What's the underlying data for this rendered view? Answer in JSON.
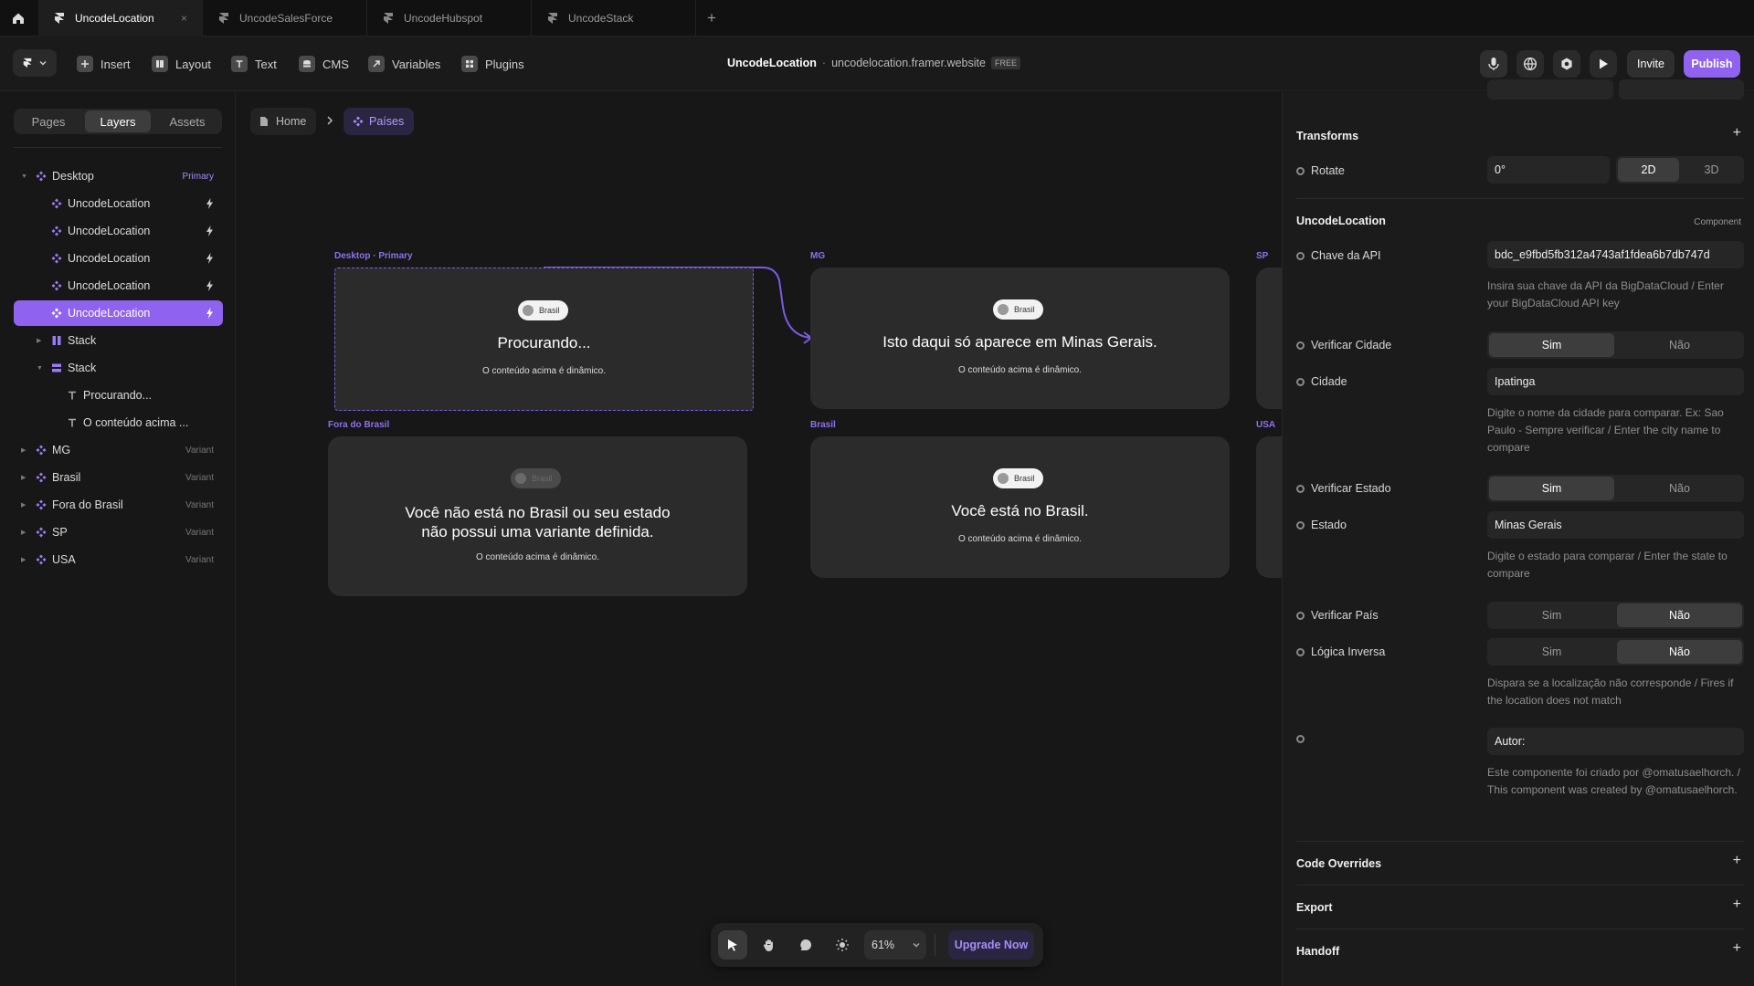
{
  "tabs": [
    {
      "label": "UncodeLocation",
      "close": "×"
    },
    {
      "label": "UncodeSalesForce"
    },
    {
      "label": "UncodeHubspot"
    },
    {
      "label": "UncodeStack"
    }
  ],
  "new_tab": "+",
  "toolbar": {
    "insert": "Insert",
    "layout": "Layout",
    "text": "Text",
    "cms": "CMS",
    "variables": "Variables",
    "plugins": "Plugins",
    "project_name": "UncodeLocation",
    "separator": "·",
    "site_url": "uncodelocation.framer.website",
    "plan_badge": "FREE",
    "invite": "Invite",
    "publish": "Publish"
  },
  "left_panel": {
    "tabs": [
      "Pages",
      "Layers",
      "Assets"
    ],
    "layers": [
      {
        "name": "Desktop",
        "tag": "Primary"
      },
      {
        "name": "UncodeLocation"
      },
      {
        "name": "UncodeLocation"
      },
      {
        "name": "UncodeLocation"
      },
      {
        "name": "UncodeLocation"
      },
      {
        "name": "UncodeLocation"
      },
      {
        "name": "Stack"
      },
      {
        "name": "Stack"
      },
      {
        "name": "Procurando..."
      },
      {
        "name": "O conteúdo acima ..."
      },
      {
        "name": "MG",
        "tag": "Variant"
      },
      {
        "name": "Brasil",
        "tag": "Variant"
      },
      {
        "name": "Fora do Brasil",
        "tag": "Variant"
      },
      {
        "name": "SP",
        "tag": "Variant"
      },
      {
        "name": "USA",
        "tag": "Variant"
      }
    ]
  },
  "canvas": {
    "breadcrumb": {
      "home": "Home",
      "current": "Países"
    },
    "frames": {
      "desktop": {
        "label": "Desktop · Primary",
        "pill": "Brasil",
        "title": "Procurando...",
        "sub": "O conteúdo acima é dinâmico."
      },
      "mg": {
        "label": "MG",
        "pill": "Brasil",
        "title": "Isto daqui só aparece em Minas Gerais.",
        "sub": "O conteúdo acima é dinâmico."
      },
      "sp": {
        "label": "SP"
      },
      "fora": {
        "label": "Fora do Brasil",
        "pill": "Brasil",
        "title": "Você não está no Brasil ou seu estado não possui uma variante definida.",
        "sub": "O conteúdo acima é dinâmico."
      },
      "brasil": {
        "label": "Brasil",
        "pill": "Brasil",
        "title": "Você está no Brasil.",
        "sub": "O conteúdo acima é dinâmico."
      },
      "usa": {
        "label": "USA"
      }
    },
    "zoom": "61%",
    "upgrade": "Upgrade Now"
  },
  "right_panel": {
    "transforms": {
      "title": "Transforms",
      "add": "+",
      "rotate_label": "Rotate",
      "rotate_value": "0°",
      "mode_2d": "2D",
      "mode_3d": "3D"
    },
    "component": {
      "title": "UncodeLocation",
      "kind": "Component",
      "api_key_label": "Chave da API",
      "api_key_value": "bdc_e9fbd5fb312a4743af1fdea6b7db747d",
      "api_key_hint": "Insira sua chave da API da BigDataCloud / Enter your BigDataCloud API key",
      "verify_city_label": "Verificar Cidade",
      "city_label": "Cidade",
      "city_value": "Ipatinga",
      "city_hint": "Digite o nome da cidade para comparar. Ex: Sao Paulo - Sempre verificar / Enter the city name to compare",
      "verify_state_label": "Verificar Estado",
      "state_label": "Estado",
      "state_value": "Minas Gerais",
      "state_hint": "Digite o estado para comparar / Enter the state to compare",
      "verify_country_label": "Verificar País",
      "inverse_label": "Lógica Inversa",
      "inverse_hint": "Dispara se a localização não corresponde / Fires if the location does not match",
      "author_value": "Autor:",
      "author_hint": "Este componente foi criado por @omatusaelhorch. / This component was created by @omatusaelhorch.",
      "yes": "Sim",
      "no": "Não"
    },
    "code_overrides": "Code Overrides",
    "export": "Export",
    "handoff": "Handoff",
    "add": "+"
  },
  "colors": {
    "accent": "#8f63f0",
    "bg": "#171717",
    "panel": "#1b1b1b"
  }
}
